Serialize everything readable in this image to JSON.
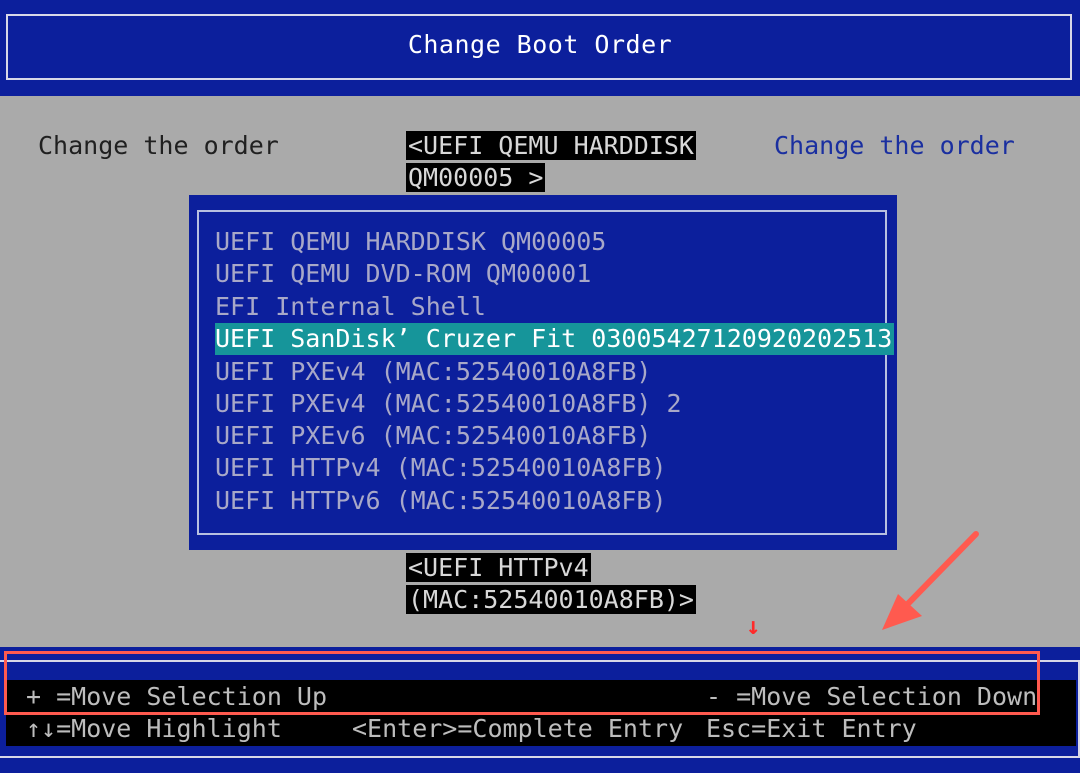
{
  "header": {
    "title": "Change Boot Order"
  },
  "main": {
    "label": "Change the order",
    "selected_value": [
      "<UEFI QEMU HARDDISK",
      "QM00005 >"
    ],
    "help_text": "Change the order",
    "next_value": [
      "<UEFI HTTPv4",
      "(MAC:52540010A8FB)>"
    ]
  },
  "popup": {
    "options": [
      {
        "label": "UEFI QEMU HARDDISK QM00005",
        "highlighted": false
      },
      {
        "label": "UEFI QEMU DVD-ROM QM00001",
        "highlighted": false
      },
      {
        "label": "EFI Internal Shell",
        "highlighted": false
      },
      {
        "label": "UEFI SanDisk’ Cruzer Fit 03005427120920202513",
        "highlighted": true
      },
      {
        "label": "UEFI PXEv4 (MAC:52540010A8FB)",
        "highlighted": false
      },
      {
        "label": "UEFI PXEv4 (MAC:52540010A8FB) 2",
        "highlighted": false
      },
      {
        "label": "UEFI PXEv6 (MAC:52540010A8FB)",
        "highlighted": false
      },
      {
        "label": "UEFI HTTPv4 (MAC:52540010A8FB)",
        "highlighted": false
      },
      {
        "label": "UEFI HTTPv6 (MAC:52540010A8FB)",
        "highlighted": false
      }
    ]
  },
  "footer": {
    "move_up": "+ =Move Selection Up",
    "move_down": "- =Move Selection Down",
    "move_highlight": "↑↓=Move Highlight",
    "complete_entry": "<Enter>=Complete Entry",
    "exit_entry": "Esc=Exit Entry"
  },
  "annotation": {
    "small_arrow": "↓",
    "colors": {
      "annotation": "#ff5a4f",
      "bios_blue": "#0c1f9c",
      "highlight": "#16959a",
      "gray": "#aaaaaa"
    }
  }
}
